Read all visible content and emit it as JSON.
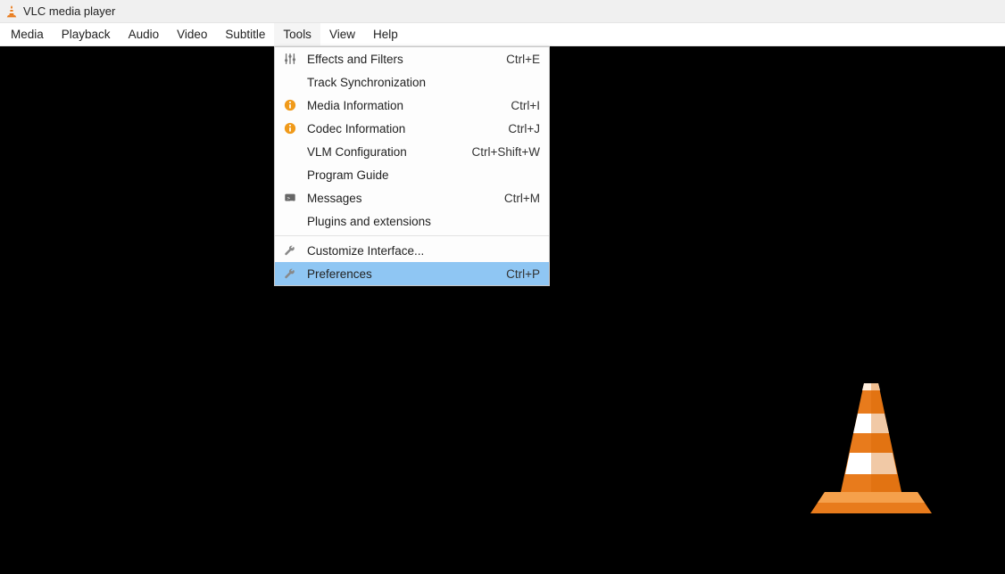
{
  "app_title": "VLC media player",
  "menubar": {
    "items": [
      {
        "label": "Media"
      },
      {
        "label": "Playback"
      },
      {
        "label": "Audio"
      },
      {
        "label": "Video"
      },
      {
        "label": "Subtitle"
      },
      {
        "label": "Tools",
        "active": true
      },
      {
        "label": "View"
      },
      {
        "label": "Help"
      }
    ]
  },
  "tools_menu": {
    "items": [
      {
        "icon": "sliders",
        "label": "Effects and Filters",
        "shortcut": "Ctrl+E"
      },
      {
        "icon": "",
        "label": "Track Synchronization",
        "shortcut": ""
      },
      {
        "icon": "info",
        "label": "Media Information",
        "shortcut": "Ctrl+I"
      },
      {
        "icon": "info",
        "label": "Codec Information",
        "shortcut": "Ctrl+J"
      },
      {
        "icon": "",
        "label": "VLM Configuration",
        "shortcut": "Ctrl+Shift+W"
      },
      {
        "icon": "",
        "label": "Program Guide",
        "shortcut": ""
      },
      {
        "icon": "messages",
        "label": "Messages",
        "shortcut": "Ctrl+M"
      },
      {
        "icon": "",
        "label": "Plugins and extensions",
        "shortcut": ""
      },
      {
        "sep": true
      },
      {
        "icon": "wrench",
        "label": "Customize Interface...",
        "shortcut": ""
      },
      {
        "icon": "wrench",
        "label": "Preferences",
        "shortcut": "Ctrl+P",
        "highlight": true
      }
    ]
  }
}
